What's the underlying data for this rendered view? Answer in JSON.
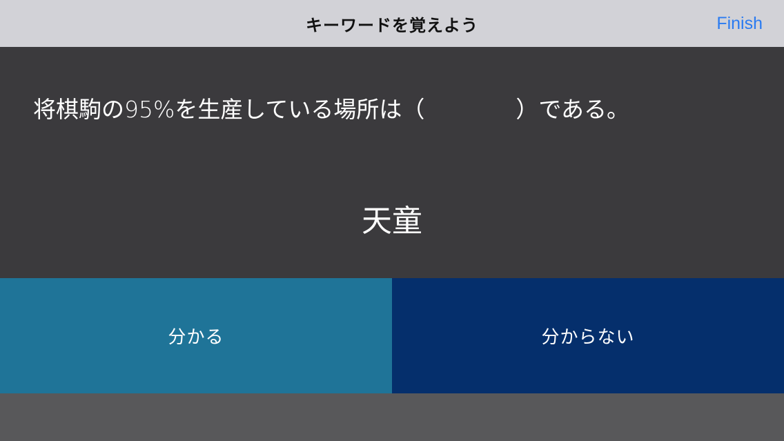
{
  "navbar": {
    "title": "キーワードを覚えよう",
    "finish_label": "Finish"
  },
  "card": {
    "question": "将棋駒の95%を生産している場所は（　　　　）である。",
    "answer": "天童"
  },
  "buttons": {
    "know_label": "分かる",
    "dont_know_label": "分からない"
  },
  "colors": {
    "navbar_bg": "#d2d2d7",
    "accent": "#2a7bf1",
    "card_bg": "#3b3a3d",
    "know_bg": "#1f7498",
    "dont_know_bg": "#052f6c"
  }
}
